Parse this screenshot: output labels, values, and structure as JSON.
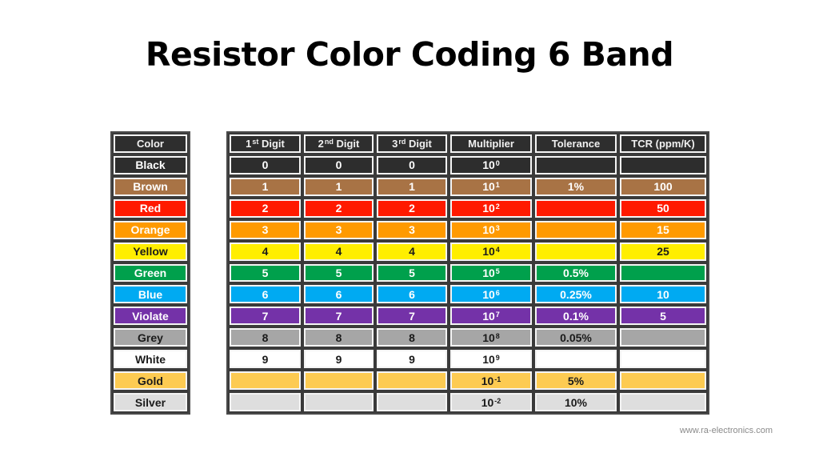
{
  "title": "Resistor Color Coding 6 Band",
  "footer": "www.ra-electronics.com",
  "color_table": {
    "header": "Color"
  },
  "value_table": {
    "headers": [
      {
        "base": "1",
        "sup": "st",
        "rest": " Digit"
      },
      {
        "base": "2",
        "sup": "nd",
        "rest": " Digit"
      },
      {
        "base": "3",
        "sup": "rd",
        "rest": " Digit"
      },
      {
        "base": "Multiplier",
        "sup": "",
        "rest": ""
      },
      {
        "base": "Tolerance",
        "sup": "",
        "rest": ""
      },
      {
        "base": "TCR (ppm/K)",
        "sup": "",
        "rest": ""
      }
    ]
  },
  "rows": [
    {
      "color": "Black",
      "bg": "#2d2d2d",
      "fg": "#ffffff",
      "d1": "0",
      "d2": "0",
      "d3": "0",
      "mult_base": "10",
      "mult_exp": "0",
      "tolerance": "",
      "tcr": ""
    },
    {
      "color": "Brown",
      "bg": "#a87345",
      "fg": "#ffffff",
      "d1": "1",
      "d2": "1",
      "d3": "1",
      "mult_base": "10",
      "mult_exp": "1",
      "tolerance": "1%",
      "tcr": "100"
    },
    {
      "color": "Red",
      "bg": "#ff1a00",
      "fg": "#ffffff",
      "d1": "2",
      "d2": "2",
      "d3": "2",
      "mult_base": "10",
      "mult_exp": "2",
      "tolerance": "",
      "tcr": "50"
    },
    {
      "color": "Orange",
      "bg": "#ff9a00",
      "fg": "#ffffff",
      "d1": "3",
      "d2": "3",
      "d3": "3",
      "mult_base": "10",
      "mult_exp": "3",
      "tolerance": "",
      "tcr": "15"
    },
    {
      "color": "Yellow",
      "bg": "#ffee00",
      "fg": "#1a1a1a",
      "d1": "4",
      "d2": "4",
      "d3": "4",
      "mult_base": "10",
      "mult_exp": "4",
      "tolerance": "",
      "tcr": "25"
    },
    {
      "color": "Green",
      "bg": "#00a04c",
      "fg": "#ffffff",
      "d1": "5",
      "d2": "5",
      "d3": "5",
      "mult_base": "10",
      "mult_exp": "5",
      "tolerance": "0.5%",
      "tcr": ""
    },
    {
      "color": "Blue",
      "bg": "#00aaf2",
      "fg": "#ffffff",
      "d1": "6",
      "d2": "6",
      "d3": "6",
      "mult_base": "10",
      "mult_exp": "6",
      "tolerance": "0.25%",
      "tcr": "10"
    },
    {
      "color": "Violate",
      "bg": "#7432a8",
      "fg": "#ffffff",
      "d1": "7",
      "d2": "7",
      "d3": "7",
      "mult_base": "10",
      "mult_exp": "7",
      "tolerance": "0.1%",
      "tcr": "5"
    },
    {
      "color": "Grey",
      "bg": "#a6a6a6",
      "fg": "#1a1a1a",
      "d1": "8",
      "d2": "8",
      "d3": "8",
      "mult_base": "10",
      "mult_exp": "8",
      "tolerance": "0.05%",
      "tcr": ""
    },
    {
      "color": "White",
      "bg": "#ffffff",
      "fg": "#1a1a1a",
      "d1": "9",
      "d2": "9",
      "d3": "9",
      "mult_base": "10",
      "mult_exp": "9",
      "tolerance": "",
      "tcr": ""
    },
    {
      "color": "Gold",
      "bg": "#fdcb52",
      "fg": "#1a1a1a",
      "d1": "",
      "d2": "",
      "d3": "",
      "mult_base": "10",
      "mult_exp": "-1",
      "tolerance": "5%",
      "tcr": ""
    },
    {
      "color": "Silver",
      "bg": "#dedede",
      "fg": "#1a1a1a",
      "d1": "",
      "d2": "",
      "d3": "",
      "mult_base": "10",
      "mult_exp": "-2",
      "tolerance": "10%",
      "tcr": ""
    }
  ]
}
